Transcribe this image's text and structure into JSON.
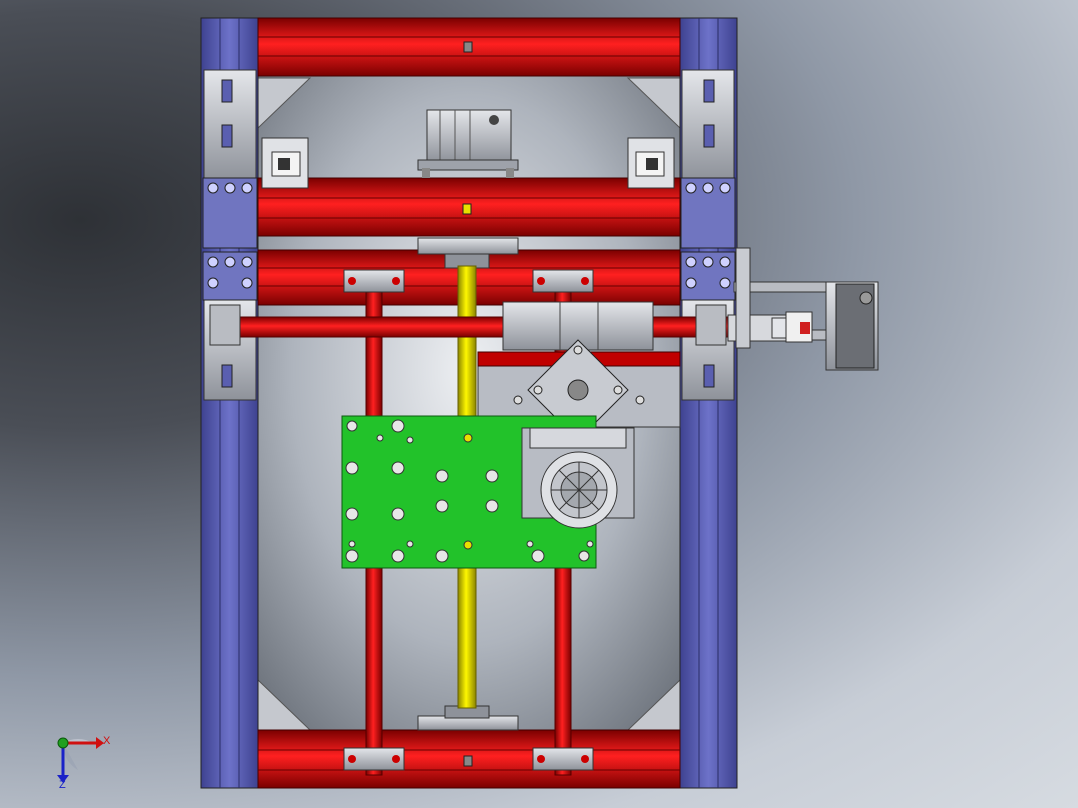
{
  "viewport": {
    "background": [
      "#2e3136",
      "#8f98a6",
      "#d6dbe1"
    ]
  },
  "colors": {
    "frame_profile": "#5a5fb0",
    "beam_red": "#c00000",
    "rod_yellow": "#e8e000",
    "pcb_green": "#22c22a",
    "metal_gray": "#b8bcc4"
  },
  "triad": {
    "x_label": "X",
    "z_label": "Z",
    "x_color": "#d01010",
    "z_color": "#1a22c8",
    "origin_color": "#20a020"
  },
  "icons": [
    "coordinate-triad-icon"
  ]
}
